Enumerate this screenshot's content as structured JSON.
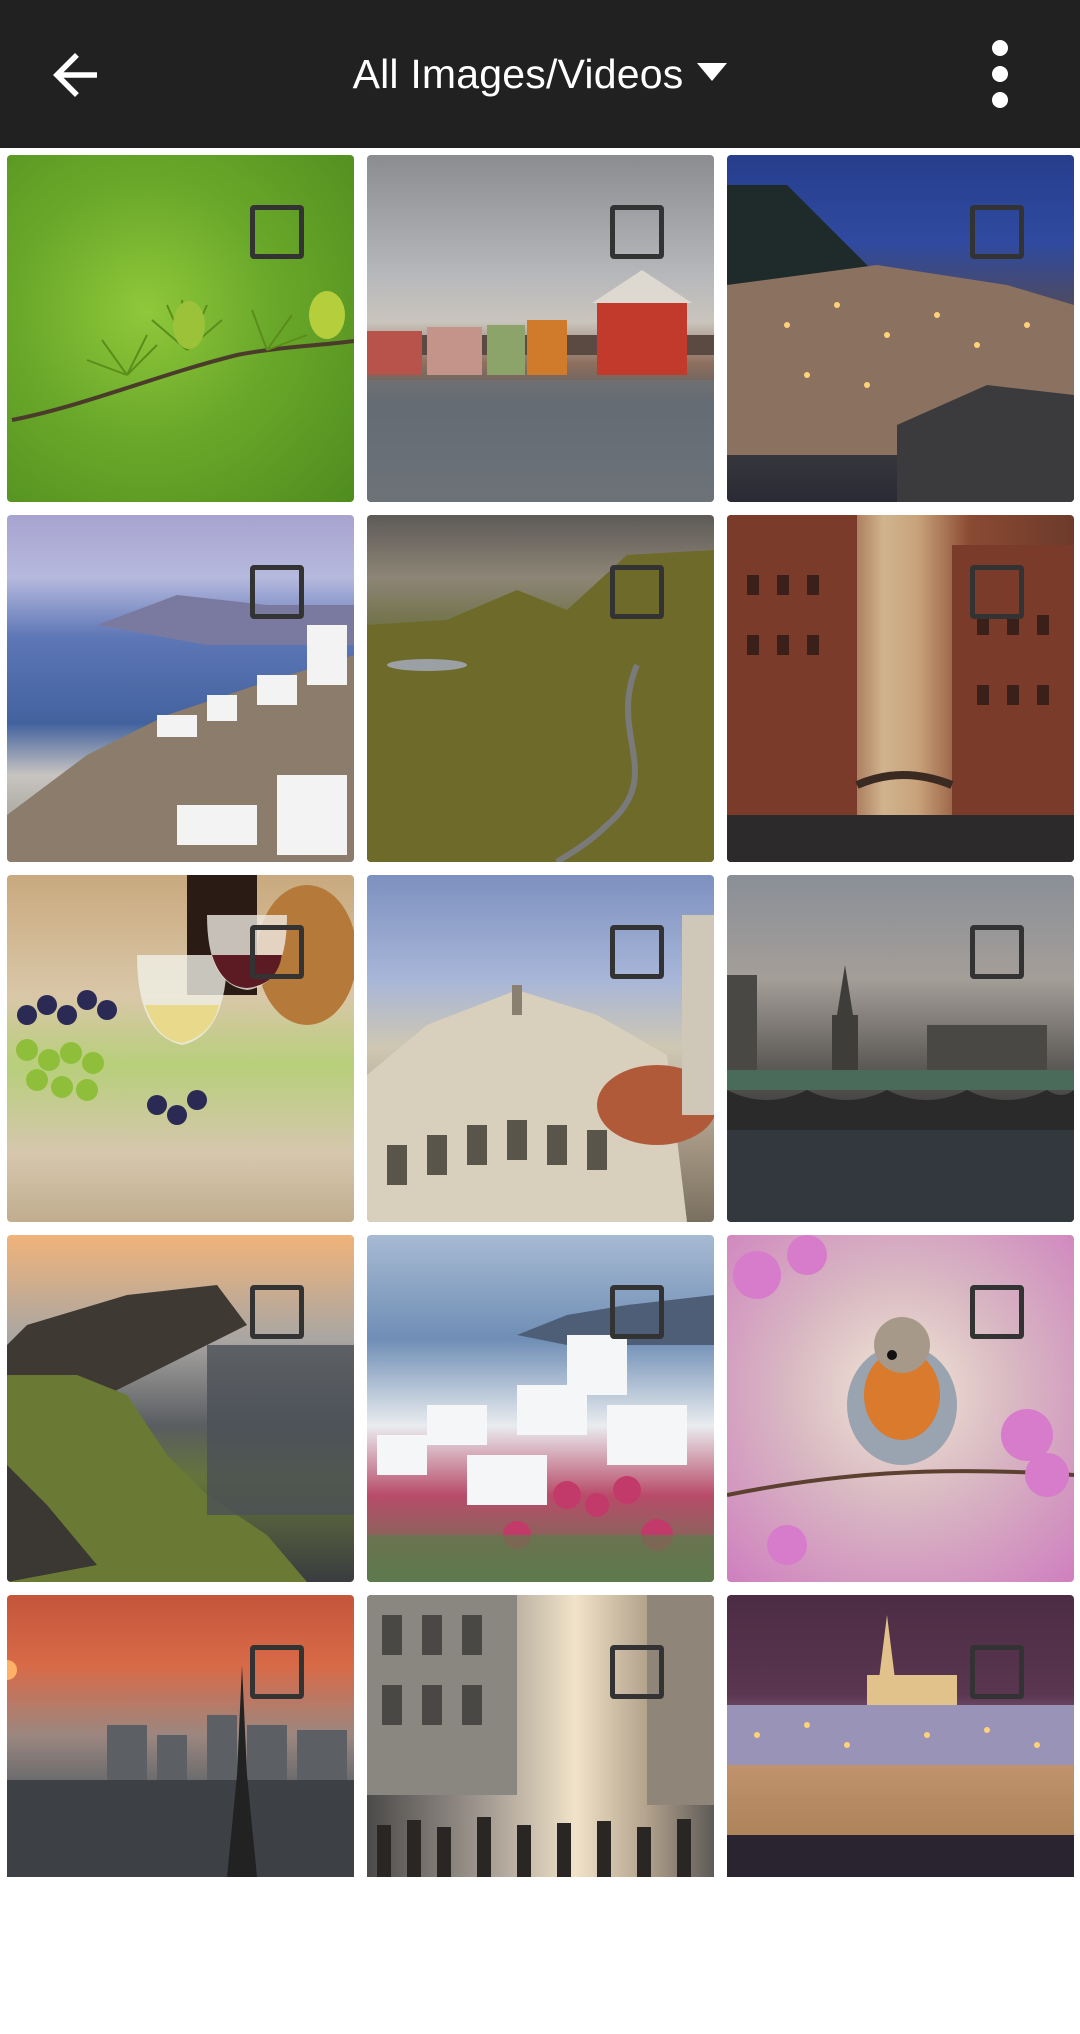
{
  "appbar": {
    "title": "All Images/Videos",
    "back_icon": "arrow-left-icon",
    "dropdown_icon": "caret-down-icon",
    "menu_icon": "more-vertical-icon",
    "background": "#212121"
  },
  "grid": {
    "items": [
      {
        "icon": "image-thumbnail",
        "subject": "larch-branch",
        "selected": false
      },
      {
        "icon": "image-thumbnail",
        "subject": "trondheim-waterfront",
        "selected": false
      },
      {
        "icon": "image-thumbnail",
        "subject": "manarola-night",
        "selected": false
      },
      {
        "icon": "image-thumbnail",
        "subject": "santorini-oia",
        "selected": false
      },
      {
        "icon": "image-thumbnail",
        "subject": "isle-of-skye",
        "selected": false
      },
      {
        "icon": "image-thumbnail",
        "subject": "hamburg-speicherstadt",
        "selected": false
      },
      {
        "icon": "image-thumbnail",
        "subject": "wine-and-grapes",
        "selected": false
      },
      {
        "icon": "image-thumbnail",
        "subject": "florence-baptistery",
        "selected": false
      },
      {
        "icon": "image-thumbnail",
        "subject": "westminster-bridge",
        "selected": false
      },
      {
        "icon": "image-thumbnail",
        "subject": "neist-point",
        "selected": false
      },
      {
        "icon": "image-thumbnail",
        "subject": "santorini-village",
        "selected": false
      },
      {
        "icon": "image-thumbnail",
        "subject": "robin-on-branch",
        "selected": false
      },
      {
        "icon": "image-thumbnail",
        "subject": "paris-eiffel-tower",
        "selected": false
      },
      {
        "icon": "image-thumbnail",
        "subject": "city-street-crowd",
        "selected": false
      },
      {
        "icon": "image-thumbnail",
        "subject": "prague-castle-night",
        "selected": false
      }
    ]
  }
}
